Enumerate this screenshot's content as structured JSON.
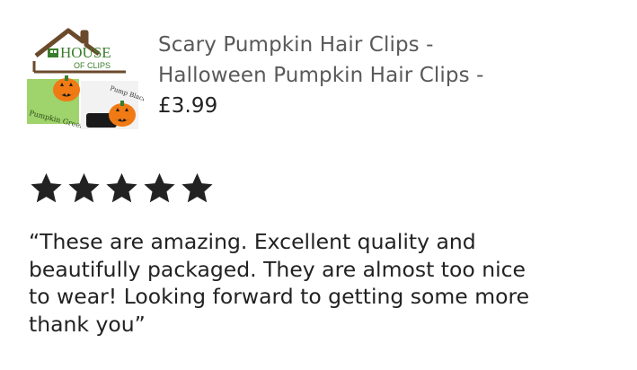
{
  "product": {
    "image": {
      "brand_line1": "HOUSE",
      "brand_line2": "OF CLIPS",
      "label_left": "Pumpkin Green",
      "label_right": "Pump Black",
      "icon": "pumpkin-hair-clip"
    },
    "title_lines": [
      "Scary Pumpkin Hair Clips -",
      "Halloween Pumpkin Hair Clips -"
    ],
    "price": "£3.99"
  },
  "rating": {
    "stars": 5,
    "max": 5,
    "icon": "star-icon",
    "color": "#222222"
  },
  "review": {
    "lines": [
      "“These are amazing. Excellent quality and",
      "beautifully packaged. They are almost too nice",
      "to wear! Looking forward to getting some more",
      "thank you”"
    ]
  },
  "colors": {
    "text": "#222222",
    "muted": "#595959",
    "brand_green": "#3a7d2c",
    "brand_brown": "#6b4a2b",
    "pumpkin": "#f07a14"
  }
}
